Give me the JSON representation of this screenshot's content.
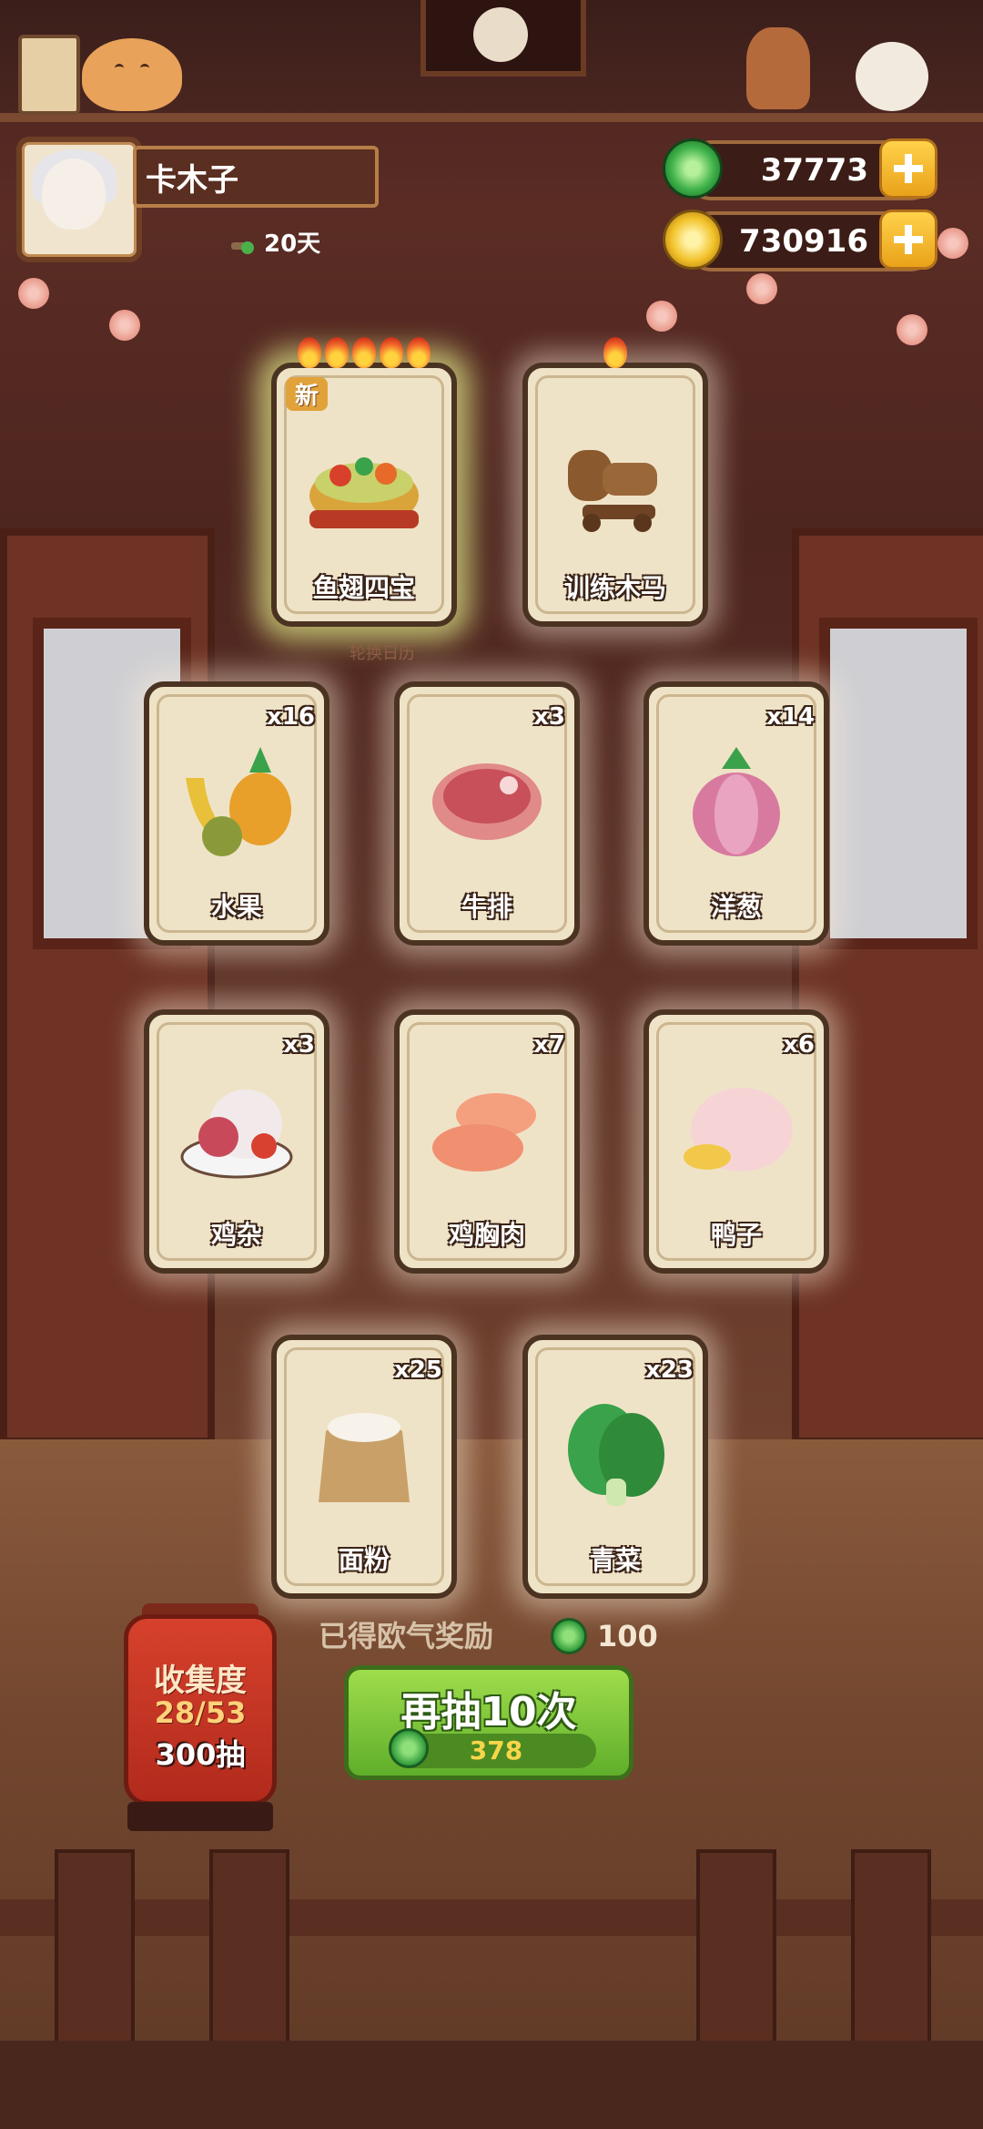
{
  "player": {
    "name": "卡木子",
    "days": "20天"
  },
  "currency": {
    "jade": "37773",
    "gold": "730916"
  },
  "featured": [
    {
      "label": "鱼翅四宝",
      "new_badge": "新",
      "flames": 5
    },
    {
      "label": "训练木马",
      "flames": 1
    }
  ],
  "calendar_label": "轮换日历",
  "cards": [
    {
      "label": "水果",
      "count": "x16"
    },
    {
      "label": "牛排",
      "count": "x3"
    },
    {
      "label": "洋葱",
      "count": "x14"
    },
    {
      "label": "鸡杂",
      "count": "x3"
    },
    {
      "label": "鸡胸肉",
      "count": "x7"
    },
    {
      "label": "鸭子",
      "count": "x6"
    },
    {
      "label": "面粉",
      "count": "x25"
    },
    {
      "label": "青菜",
      "count": "x23"
    }
  ],
  "reward": {
    "text": "已得欧气奖励",
    "value": "100"
  },
  "draw_button": {
    "label": "再抽10次",
    "cost": "378"
  },
  "collection": {
    "title": "收集度",
    "progress": "28/53",
    "pulls": "300抽"
  },
  "colors": {
    "jade": "#2f9a3a",
    "gold": "#e9b21a",
    "button_green": "#6dbb32",
    "card_bg": "#efe3c7"
  },
  "icons": {
    "jade": "jade-coin-icon",
    "gold": "gold-coin-icon",
    "plus": "plus-icon",
    "days": "sprout-icon"
  }
}
